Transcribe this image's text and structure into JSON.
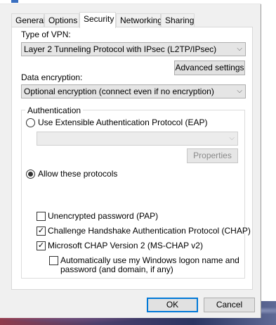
{
  "tabs": [
    "General",
    "Options",
    "Security",
    "Networking",
    "Sharing"
  ],
  "active_tab": "Security",
  "vpn_type": {
    "label": "Type of VPN:",
    "value": "Layer 2 Tunneling Protocol with IPsec (L2TP/IPsec)"
  },
  "advanced_settings_label": "Advanced settings",
  "data_encryption": {
    "label": "Data encryption:",
    "value": "Optional encryption (connect even if no encryption)"
  },
  "authentication": {
    "title": "Authentication",
    "eap_option": "Use Extensible Authentication Protocol (EAP)",
    "eap_selected": false,
    "eap_combo_value": "",
    "properties_label": "Properties",
    "allow_option": "Allow these protocols",
    "allow_selected": true,
    "protocols": [
      {
        "label": "Unencrypted password (PAP)",
        "checked": false
      },
      {
        "label": "Challenge Handshake Authentication Protocol (CHAP)",
        "checked": true
      },
      {
        "label": "Microsoft CHAP Version 2 (MS-CHAP v2)",
        "checked": true
      }
    ],
    "auto_logon": {
      "line1": "Automatically use my Windows logon name and",
      "line2": "password (and domain, if any)",
      "checked": false
    }
  },
  "footer": {
    "ok_label": "OK",
    "cancel_label": "Cancel"
  },
  "glyphs": {
    "chevron": "⌵",
    "check": "✓"
  }
}
